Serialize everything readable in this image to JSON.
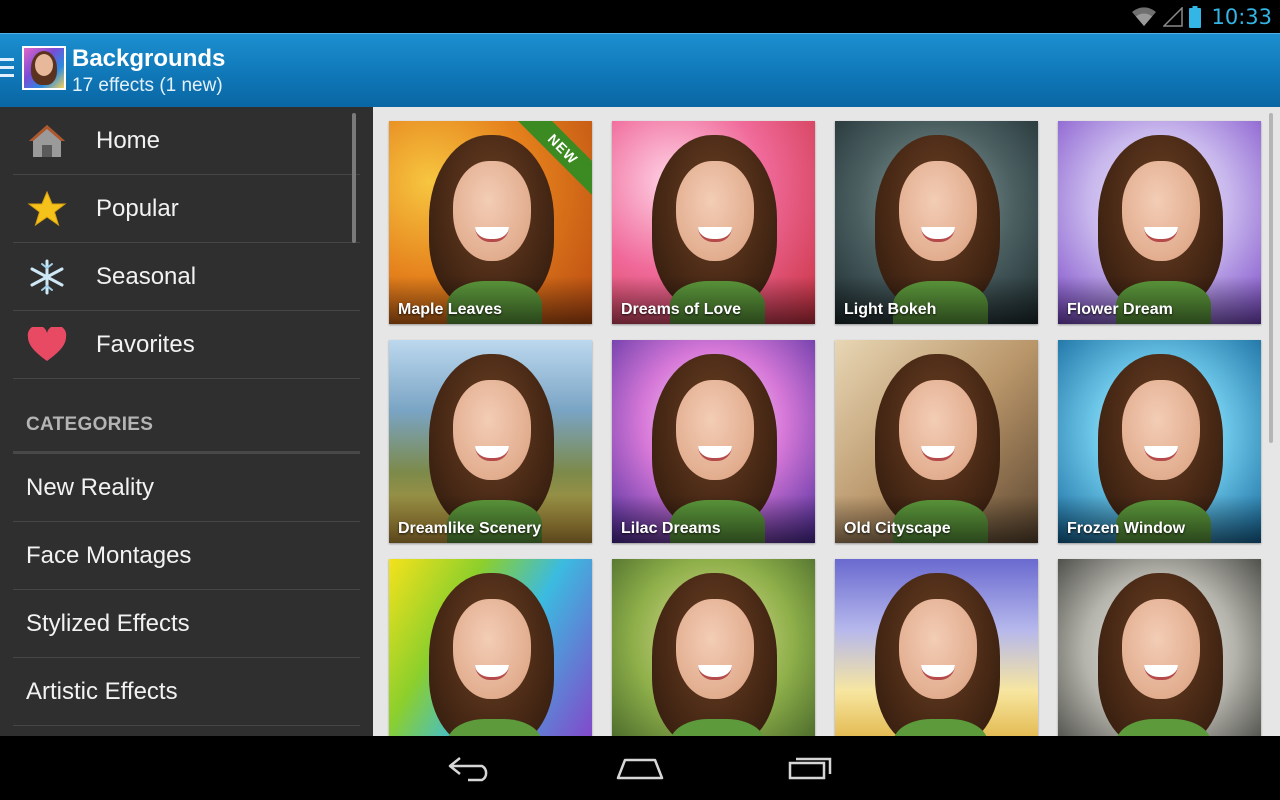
{
  "status_bar": {
    "time": "10:33"
  },
  "action_bar": {
    "title": "Backgrounds",
    "subtitle": "17 effects (1 new)"
  },
  "sidebar": {
    "nav_items": [
      {
        "label": "Home",
        "icon": "home-icon"
      },
      {
        "label": "Popular",
        "icon": "star-icon"
      },
      {
        "label": "Seasonal",
        "icon": "snowflake-icon"
      },
      {
        "label": "Favorites",
        "icon": "heart-icon"
      }
    ],
    "categories_header": "CATEGORIES",
    "categories": [
      {
        "label": "New Reality"
      },
      {
        "label": "Face Montages"
      },
      {
        "label": "Stylized Effects"
      },
      {
        "label": "Artistic Effects"
      }
    ]
  },
  "grid": {
    "new_badge": "NEW",
    "tiles": [
      {
        "label": "Maple Leaves",
        "is_new": true
      },
      {
        "label": "Dreams of Love"
      },
      {
        "label": "Light Bokeh"
      },
      {
        "label": "Flower Dream"
      },
      {
        "label": "Dreamlike Scenery"
      },
      {
        "label": "Lilac Dreams"
      },
      {
        "label": "Old Cityscape"
      },
      {
        "label": "Frozen Window"
      },
      {
        "label": ""
      },
      {
        "label": ""
      },
      {
        "label": ""
      },
      {
        "label": ""
      }
    ]
  },
  "colors": {
    "accent": "#33b5e5",
    "action_bar": "#1078b8",
    "sidebar_bg": "#2f2f2f",
    "grid_bg": "#e6e6e6",
    "heart": "#e84a64",
    "star": "#f5c21b"
  }
}
